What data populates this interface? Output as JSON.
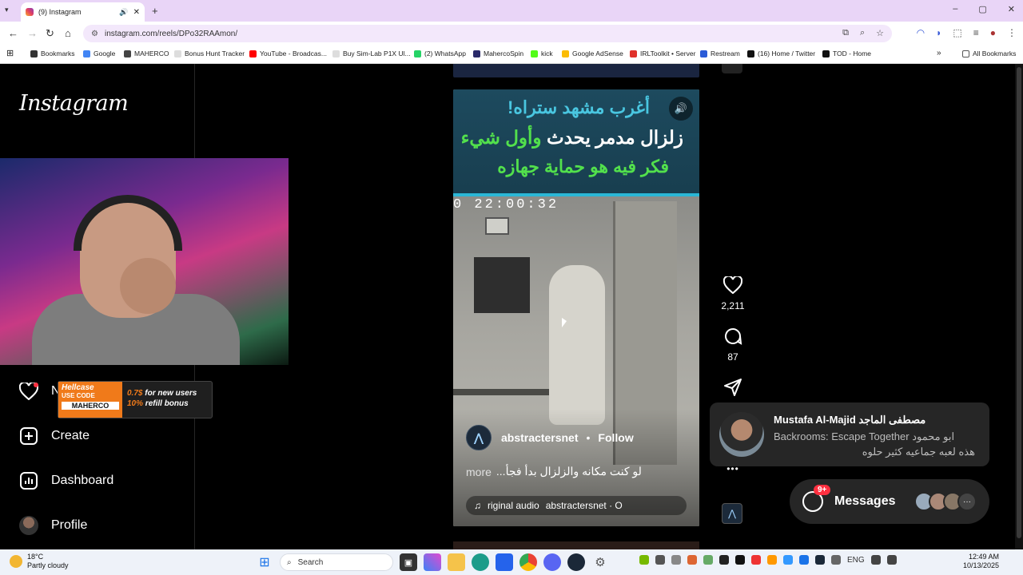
{
  "browser": {
    "tab_title": "(9) Instagram",
    "tab_audio_icon": "speaker-icon",
    "new_tab_label": "+",
    "url": "instagram.com/reels/DPo32RAAmon/",
    "window_controls": [
      "–",
      "▢",
      "✕"
    ]
  },
  "bookmarks": [
    {
      "label": "Bookmarks",
      "color": "#333333"
    },
    {
      "label": "Google",
      "color": "#4285f4"
    },
    {
      "label": "MAHERCO",
      "color": "#444444"
    },
    {
      "label": "Bonus Hunt Tracker",
      "color": "#bbbbbb"
    },
    {
      "label": "YouTube - Broadcas...",
      "color": "#ff0000"
    },
    {
      "label": "Buy Sim-Lab P1X Ul...",
      "color": "#bbbbbb"
    },
    {
      "label": "(2) WhatsApp",
      "color": "#25d366"
    },
    {
      "label": "MahercoSpin",
      "color": "#2a2a6a"
    },
    {
      "label": "kick",
      "color": "#53fc18"
    },
    {
      "label": "Google AdSense",
      "color": "#fbbc04"
    },
    {
      "label": "IRLToolkit • Server",
      "color": "#e0312b"
    },
    {
      "label": "Restream",
      "color": "#2a5bd7"
    },
    {
      "label": "(16) Home / Twitter",
      "color": "#111111"
    },
    {
      "label": "TOD - Home",
      "color": "#111111"
    }
  ],
  "all_bookmarks_label": "All Bookmarks",
  "sidebar": {
    "logo": "Instagram",
    "notifications_label": "N",
    "create_label": "Create",
    "dashboard_label": "Dashboard",
    "profile_label": "Profile"
  },
  "overlay": {
    "brand": "Hellcase",
    "use_code": "USE CODE",
    "code": "MAHERCO",
    "offer_line1_value": "0.7$",
    "offer_line1_text": "for new users",
    "offer_line2_value": "10%",
    "offer_line2_text": "refill bonus"
  },
  "reel": {
    "headline_line1": "أغرب مشهد ستراه!",
    "headline_line2_white": "زلزال مدمر يحدث",
    "headline_line2_green": "وأول شيء",
    "headline_line3": "فكر فيه هو حماية جهازه",
    "timestamp": "0 22:00:32",
    "author": "abstractersnet",
    "follow_label": "Follow",
    "caption": "لو كنت مكانه والزلزال بدأ فجأ...",
    "more_label": "more",
    "audio_text": "riginal audio",
    "audio_author": "abstractersnet · O"
  },
  "actions": {
    "likes": "2,211",
    "comments": "87",
    "more_label": "•••"
  },
  "notification": {
    "name": "Mustafa Al-Majid مصطفى الماجد",
    "group": "Backrooms: Escape Together ابو محمود",
    "text": "هذه لعبه جماعيه كثير حلوه"
  },
  "messages": {
    "label": "Messages",
    "badge": "9+",
    "more": "···"
  },
  "taskbar": {
    "temp": "18°C",
    "weather": "Partly cloudy",
    "search_placeholder": "Search",
    "lang": "ENG",
    "time": "12:49 AM",
    "date": "10/13/2025"
  }
}
